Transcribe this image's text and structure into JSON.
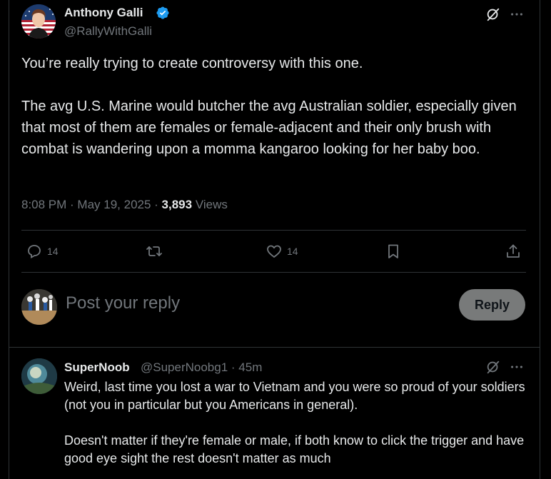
{
  "tweet": {
    "author_name": "Anthony Galli",
    "author_handle": "@RallyWithGalli",
    "text": "You’re really trying to create controversy with this one.\n\nThe avg U.S. Marine would butcher the avg Australian soldier, especially given that most of them are females or female-adjacent and their only brush with combat is wandering upon a momma kangaroo looking for her baby boo.",
    "time": "8:08 PM",
    "date": "May 19, 2025",
    "views_count": "3,893",
    "views_label": "Views",
    "separator": " · ",
    "replies": "14",
    "likes": "14"
  },
  "icons": {
    "verified": "verified-badge-icon",
    "grok": "grok-icon",
    "more": "more-icon",
    "reply": "reply-icon",
    "retweet": "retweet-icon",
    "like": "like-icon",
    "bookmark": "bookmark-icon",
    "share": "share-icon"
  },
  "reply_box": {
    "placeholder": "Post your reply",
    "button_label": "Reply"
  },
  "comment": {
    "author_name": "SuperNoob",
    "author_handle": "@SuperNoobg1",
    "separator": " · ",
    "time": "45m",
    "text": "Weird, last time you lost a war to Vietnam and you were so proud of your soldiers (not you in particular but you Americans in general).\n\nDoesn't matter if they're female or male, if both know to click the trigger and have good eye sight the rest doesn't matter as much"
  },
  "colors": {
    "background": "#000000",
    "text": "#e7e9ea",
    "muted": "#71767b",
    "divider": "#2f3336",
    "verified_blue": "#1d9bf0",
    "reply_button_bg": "#787a7a"
  }
}
